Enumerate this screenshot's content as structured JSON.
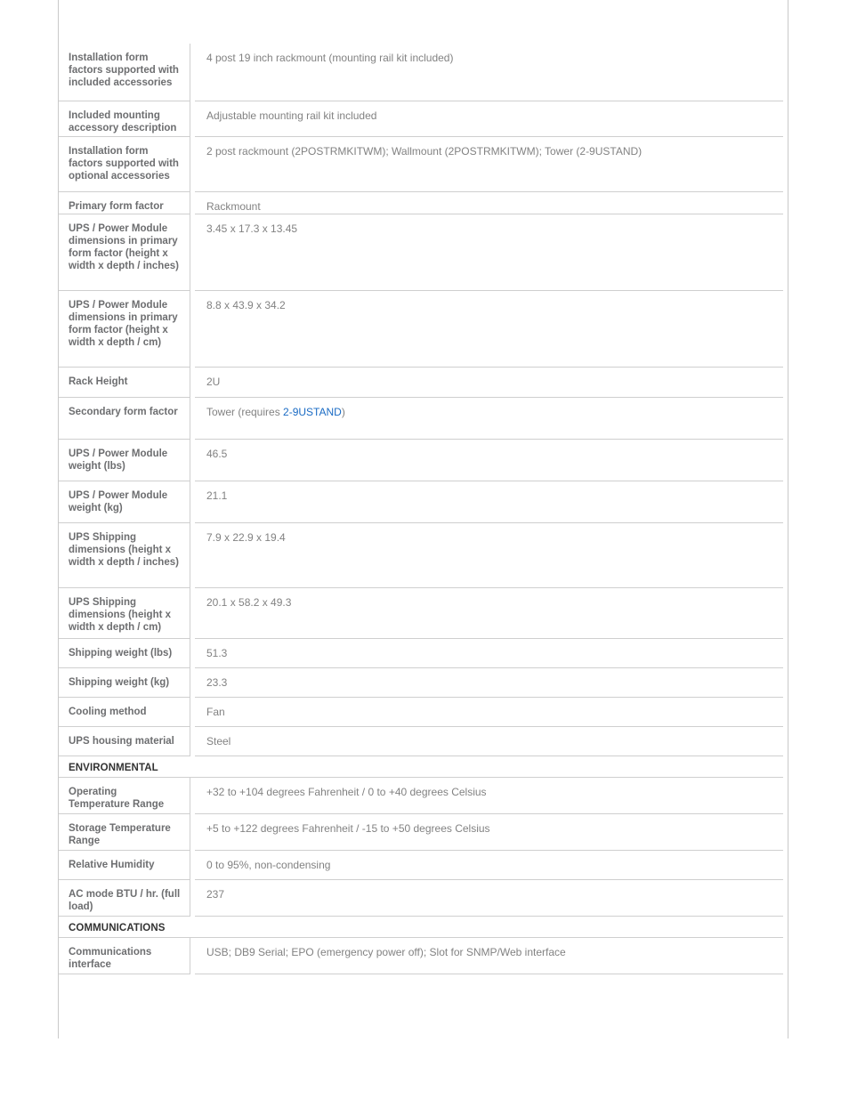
{
  "colors": {
    "label_text": "#6d6e70",
    "value_text": "#828282",
    "section_text": "#333333",
    "link": "#1a6bc4",
    "border": "#cfcfcf",
    "outer_border": "#c9c9c9",
    "background": "#ffffff"
  },
  "table": {
    "rows": [
      {
        "kind": "row",
        "label": "Installation form factors supported with included accessories",
        "value": "4 post 19 inch rackmount (mounting rail kit included)",
        "height_class": "h-a"
      },
      {
        "kind": "row",
        "label": "Included mounting accessory description",
        "value": "Adjustable mounting rail kit included",
        "height_class": "h-b"
      },
      {
        "kind": "row",
        "label": "Installation form factors supported with optional accessories",
        "value": "2 post rackmount (2POSTRMKITWM); Wallmount (2POSTRMKITWM); Tower (2-9USTAND)",
        "height_class": "h-c"
      },
      {
        "kind": "row",
        "label": "Primary form factor",
        "value": "Rackmount",
        "height_class": "h-d"
      },
      {
        "kind": "row",
        "label": "UPS / Power Module dimensions in primary form factor (height x width x depth / inches)",
        "value": "3.45 x 17.3 x 13.45",
        "height_class": "h-e"
      },
      {
        "kind": "row",
        "label": "UPS / Power Module dimensions in primary form factor (height x width x depth / cm)",
        "value": "8.8 x 43.9 x 34.2",
        "height_class": "h-e"
      },
      {
        "kind": "row",
        "label": "Rack Height",
        "value": "2U",
        "height_class": "h-f"
      },
      {
        "kind": "row",
        "label": "Secondary form factor",
        "value_prefix": "Tower (requires ",
        "value_link": "2-9USTAND",
        "value_suffix": ")",
        "value": "Tower (requires 2-9USTAND)",
        "height_class": "h-g"
      },
      {
        "kind": "row",
        "label": "UPS / Power Module weight (lbs)",
        "value": "46.5",
        "height_class": "h-g"
      },
      {
        "kind": "row",
        "label": "UPS / Power Module weight (kg)",
        "value": "21.1",
        "height_class": "h-g"
      },
      {
        "kind": "row",
        "label": "UPS Shipping dimensions (height x width x depth / inches)",
        "value": "7.9 x 22.9 x 19.4",
        "height_class": "h-h"
      },
      {
        "kind": "row",
        "label": "UPS Shipping dimensions (height x width x depth / cm)",
        "value": "20.1 x 58.2 x 49.3",
        "height_class": "h-i"
      },
      {
        "kind": "row",
        "label": "Shipping weight (lbs)",
        "value": "51.3",
        "height_class": "h-j"
      },
      {
        "kind": "row",
        "label": "Shipping weight (kg)",
        "value": "23.3",
        "height_class": "h-j"
      },
      {
        "kind": "row",
        "label": "Cooling method",
        "value": "Fan",
        "height_class": "h-j"
      },
      {
        "kind": "row",
        "label": "UPS housing material",
        "value": "Steel",
        "height_class": "h-j"
      },
      {
        "kind": "section",
        "label": "ENVIRONMENTAL",
        "height_class": "h-sec"
      },
      {
        "kind": "row",
        "label": "Operating Temperature Range",
        "value": "+32 to +104 degrees Fahrenheit / 0 to +40 degrees Celsius",
        "height_class": "h-k"
      },
      {
        "kind": "row",
        "label": "Storage Temperature Range",
        "value": "+5 to +122 degrees Fahrenheit / -15 to +50 degrees Celsius",
        "height_class": "h-k"
      },
      {
        "kind": "row",
        "label": "Relative Humidity",
        "value": "0 to 95%, non-condensing",
        "height_class": "h-j"
      },
      {
        "kind": "row",
        "label": "AC mode BTU / hr. (full load)",
        "value": "237",
        "height_class": "h-k"
      },
      {
        "kind": "section",
        "label": "COMMUNICATIONS",
        "height_class": "h-sec"
      },
      {
        "kind": "row",
        "label": "Communications interface",
        "value": "USB; DB9 Serial; EPO (emergency power off); Slot for SNMP/Web interface",
        "height_class": "h-k"
      }
    ]
  }
}
